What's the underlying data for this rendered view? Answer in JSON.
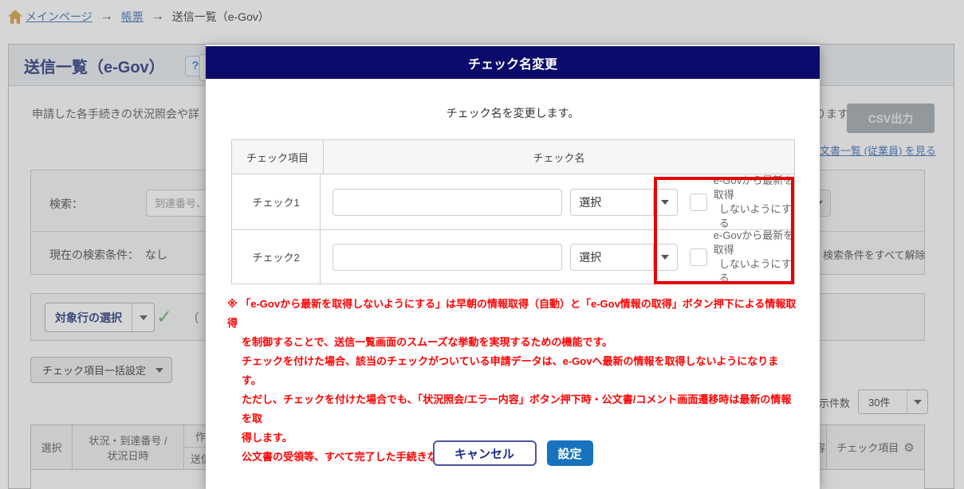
{
  "colors": {
    "modal_header_bg": "#0b0b6b",
    "highlight_border": "#e60000",
    "note_text": "#ff0000",
    "submit_bg": "#1773be",
    "cancel_border": "#4a55a2",
    "link_blue": "#3a6db4",
    "title_navy": "#21337a",
    "home_icon_gold": "#d2a13f",
    "check_green": "#5cb85c"
  },
  "breadcrumb": {
    "separator": "→",
    "items": [
      {
        "label": "メインページ"
      },
      {
        "label": "帳票"
      },
      {
        "label": "送信一覧（e-Gov）"
      }
    ]
  },
  "page": {
    "title": "送信一覧（e-Gov）",
    "help_button": "?",
    "description_left": "申請した各手続きの状況照会や詳",
    "description_right": "ります。",
    "csv_button": "CSV出力",
    "doc_list_link": "公文書一覧 (従業員) を見る",
    "search_label": "検索：",
    "search_placeholder": "到達番号、",
    "current_condition_label": "現在の検索条件：",
    "current_condition_value": "なし",
    "clear_conditions": "検索条件をすべて解除",
    "target_row_button": "対象行の選択",
    "check_mark": "✓",
    "paren_fragment": "(",
    "bulk_set_button": "チェック項目一括設定",
    "page_size_label": "表示件数",
    "page_size_value": "30件",
    "list_table": {
      "col_select": "選択",
      "col_status_line1": "状況・到達番号 /",
      "col_status_line2": "状況日時",
      "col_partial_top": "作",
      "col_partial_bottom": "送信者",
      "col_partial_right": "内容",
      "col_check_items": "チェック項目"
    }
  },
  "modal": {
    "title": "チェック名変更",
    "subtitle": "チェック名を変更します。",
    "table": {
      "col_item": "チェック項目",
      "col_name": "チェック名",
      "rows": [
        {
          "item": "チェック1",
          "input_value": "",
          "select_value": "選択",
          "checkbox_line1": "e-Govから最新を取得",
          "checkbox_line2": "しないようにする"
        },
        {
          "item": "チェック2",
          "input_value": "",
          "select_value": "選択",
          "checkbox_line1": "e-Govから最新を取得",
          "checkbox_line2": "しないようにする"
        }
      ]
    },
    "note_lines": [
      "※ 「e-Govから最新を取得しないようにする」は早朝の情報取得（自動）と「e-Gov情報の取得」ボタン押下による情報取得",
      "を制御することで、送信一覧画面のスムーズな挙動を実現するための機能です。",
      "チェックを付けた場合、該当のチェックがついている申請データは、e-Govへ最新の情報を取得しないようになります。",
      "ただし、チェックを付けた場合でも、「状況照会/エラー内容」ボタン押下時・公文書/コメント画面遷移時は最新の情報を取",
      "得します。",
      "公文書の受領等、すべて完了した手続きなどにご利用ください。"
    ],
    "cancel_button": "キャンセル",
    "submit_button": "設定"
  }
}
